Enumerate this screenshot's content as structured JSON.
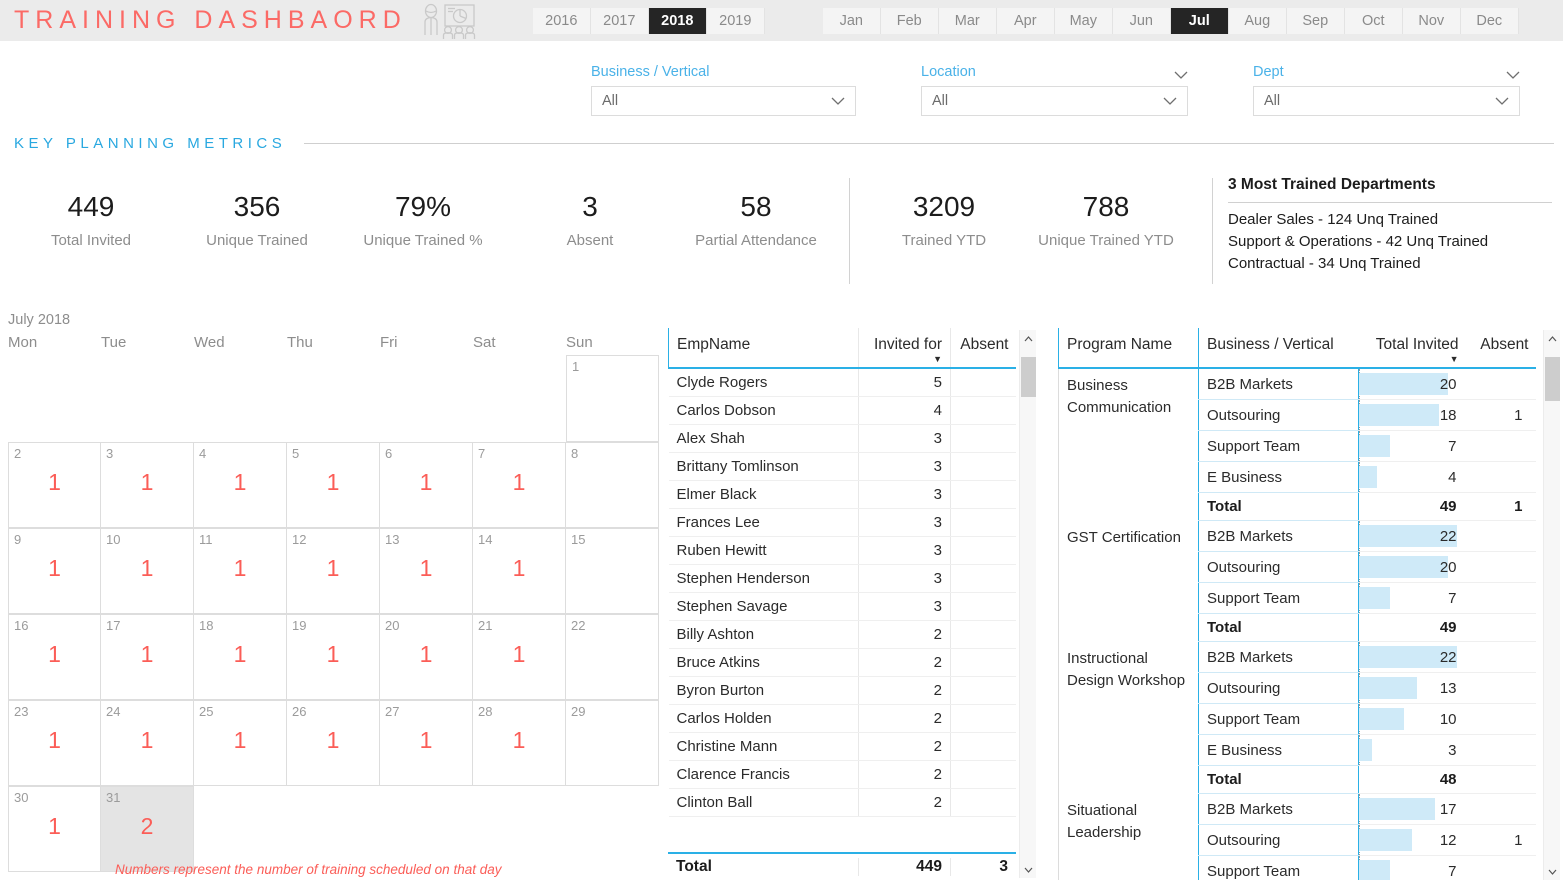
{
  "header": {
    "title": "TRAINING DASHBAORD",
    "icon": "training-presentation-icon",
    "years": [
      {
        "label": "2016",
        "selected": false
      },
      {
        "label": "2017",
        "selected": false
      },
      {
        "label": "2018",
        "selected": true
      },
      {
        "label": "2019",
        "selected": false
      }
    ],
    "months": [
      {
        "label": "Jan",
        "selected": false
      },
      {
        "label": "Feb",
        "selected": false
      },
      {
        "label": "Mar",
        "selected": false
      },
      {
        "label": "Apr",
        "selected": false
      },
      {
        "label": "May",
        "selected": false
      },
      {
        "label": "Jun",
        "selected": false
      },
      {
        "label": "Jul",
        "selected": true
      },
      {
        "label": "Aug",
        "selected": false
      },
      {
        "label": "Sep",
        "selected": false
      },
      {
        "label": "Oct",
        "selected": false
      },
      {
        "label": "Nov",
        "selected": false
      },
      {
        "label": "Dec",
        "selected": false
      }
    ]
  },
  "filters": [
    {
      "label": "Business / Vertical",
      "value": "All",
      "has_header_chevron": false
    },
    {
      "label": "Location",
      "value": "All",
      "has_header_chevron": true
    },
    {
      "label": "Dept",
      "value": "All",
      "has_header_chevron": true
    }
  ],
  "metrics_section": {
    "title": "KEY PLANNING METRICS",
    "kpis": [
      {
        "value": "449",
        "label": "Total Invited"
      },
      {
        "value": "356",
        "label": "Unique Trained"
      },
      {
        "value": "79%",
        "label": "Unique Trained %"
      },
      {
        "value": "3",
        "label": "Absent"
      },
      {
        "value": "58",
        "label": "Partial Attendance"
      },
      {
        "value": "3209",
        "label": "Trained YTD"
      },
      {
        "value": "788",
        "label": "Unique Trained YTD"
      }
    ],
    "departments": {
      "title": "3 Most Trained Departments",
      "lines": [
        "Dealer Sales - 124 Unq Trained",
        "Support & Operations - 42 Unq Trained",
        "Contractual - 34 Unq Trained"
      ]
    }
  },
  "calendar": {
    "title": "July 2018",
    "dows": [
      "Mon",
      "Tue",
      "Wed",
      "Thu",
      "Fri",
      "Sat",
      "Sun"
    ],
    "note": "Numbers represent the number of training scheduled on that day",
    "weeks": [
      [
        null,
        null,
        null,
        null,
        null,
        null,
        {
          "day": "1",
          "count": ""
        }
      ],
      [
        {
          "day": "2",
          "count": "1"
        },
        {
          "day": "3",
          "count": "1"
        },
        {
          "day": "4",
          "count": "1"
        },
        {
          "day": "5",
          "count": "1"
        },
        {
          "day": "6",
          "count": "1"
        },
        {
          "day": "7",
          "count": "1"
        },
        {
          "day": "8",
          "count": ""
        }
      ],
      [
        {
          "day": "9",
          "count": "1"
        },
        {
          "day": "10",
          "count": "1"
        },
        {
          "day": "11",
          "count": "1"
        },
        {
          "day": "12",
          "count": "1"
        },
        {
          "day": "13",
          "count": "1"
        },
        {
          "day": "14",
          "count": "1"
        },
        {
          "day": "15",
          "count": ""
        }
      ],
      [
        {
          "day": "16",
          "count": "1"
        },
        {
          "day": "17",
          "count": "1"
        },
        {
          "day": "18",
          "count": "1"
        },
        {
          "day": "19",
          "count": "1"
        },
        {
          "day": "20",
          "count": "1"
        },
        {
          "day": "21",
          "count": "1"
        },
        {
          "day": "22",
          "count": ""
        }
      ],
      [
        {
          "day": "23",
          "count": "1"
        },
        {
          "day": "24",
          "count": "1"
        },
        {
          "day": "25",
          "count": "1"
        },
        {
          "day": "26",
          "count": "1"
        },
        {
          "day": "27",
          "count": "1"
        },
        {
          "day": "28",
          "count": "1"
        },
        {
          "day": "29",
          "count": ""
        }
      ],
      [
        {
          "day": "30",
          "count": "1"
        },
        {
          "day": "31",
          "count": "2",
          "highlight": true
        },
        null,
        null,
        null,
        null,
        null
      ]
    ]
  },
  "employee_table": {
    "columns": [
      "EmpName",
      "Invited for",
      "Absent"
    ],
    "sorted_column": "Invited for",
    "rows": [
      {
        "name": "Clyde Rogers",
        "invited": "5",
        "absent": ""
      },
      {
        "name": "Carlos Dobson",
        "invited": "4",
        "absent": ""
      },
      {
        "name": "Alex Shah",
        "invited": "3",
        "absent": ""
      },
      {
        "name": "Brittany Tomlinson",
        "invited": "3",
        "absent": ""
      },
      {
        "name": "Elmer Black",
        "invited": "3",
        "absent": ""
      },
      {
        "name": "Frances Lee",
        "invited": "3",
        "absent": ""
      },
      {
        "name": "Ruben Hewitt",
        "invited": "3",
        "absent": ""
      },
      {
        "name": "Stephen Henderson",
        "invited": "3",
        "absent": ""
      },
      {
        "name": "Stephen Savage",
        "invited": "3",
        "absent": ""
      },
      {
        "name": "Billy Ashton",
        "invited": "2",
        "absent": ""
      },
      {
        "name": "Bruce Atkins",
        "invited": "2",
        "absent": ""
      },
      {
        "name": "Byron Burton",
        "invited": "2",
        "absent": ""
      },
      {
        "name": "Carlos Holden",
        "invited": "2",
        "absent": ""
      },
      {
        "name": "Christine Mann",
        "invited": "2",
        "absent": ""
      },
      {
        "name": "Clarence Francis",
        "invited": "2",
        "absent": ""
      },
      {
        "name": "Clinton Ball",
        "invited": "2",
        "absent": ""
      }
    ],
    "total": {
      "label": "Total",
      "invited": "449",
      "absent": "3"
    }
  },
  "program_table": {
    "columns": [
      "Program Name",
      "Business / Vertical",
      "Total Invited",
      "Absent"
    ],
    "sorted_column": "Total Invited",
    "bar_max": 22,
    "groups": [
      {
        "program": "Business Communication",
        "rows": [
          {
            "vertical": "B2B Markets",
            "invited": 20,
            "absent": ""
          },
          {
            "vertical": "Outsouring",
            "invited": 18,
            "absent": "1"
          },
          {
            "vertical": "Support Team",
            "invited": 7,
            "absent": ""
          },
          {
            "vertical": "E Business",
            "invited": 4,
            "absent": ""
          }
        ],
        "total": {
          "label": "Total",
          "invited": "49",
          "absent": "1"
        }
      },
      {
        "program": "GST Certification",
        "rows": [
          {
            "vertical": "B2B Markets",
            "invited": 22,
            "absent": ""
          },
          {
            "vertical": "Outsouring",
            "invited": 20,
            "absent": ""
          },
          {
            "vertical": "Support Team",
            "invited": 7,
            "absent": ""
          }
        ],
        "total": {
          "label": "Total",
          "invited": "49",
          "absent": ""
        }
      },
      {
        "program": "Instructional Design Workshop",
        "rows": [
          {
            "vertical": "B2B Markets",
            "invited": 22,
            "absent": ""
          },
          {
            "vertical": "Outsouring",
            "invited": 13,
            "absent": ""
          },
          {
            "vertical": "Support Team",
            "invited": 10,
            "absent": ""
          },
          {
            "vertical": "E Business",
            "invited": 3,
            "absent": ""
          }
        ],
        "total": {
          "label": "Total",
          "invited": "48",
          "absent": ""
        }
      },
      {
        "program": "Situational Leadership",
        "rows": [
          {
            "vertical": "B2B Markets",
            "invited": 17,
            "absent": ""
          },
          {
            "vertical": "Outsouring",
            "invited": 12,
            "absent": "1"
          },
          {
            "vertical": "Support Team",
            "invited": 7,
            "absent": ""
          }
        ],
        "total": null
      }
    ]
  },
  "colors": {
    "accent_red": "#fb6a66",
    "accent_blue": "#29a8e0",
    "bar_blue": "#cfeaf8",
    "topbar_bg": "#ebebeb",
    "selected_tab_bg": "#252525"
  }
}
